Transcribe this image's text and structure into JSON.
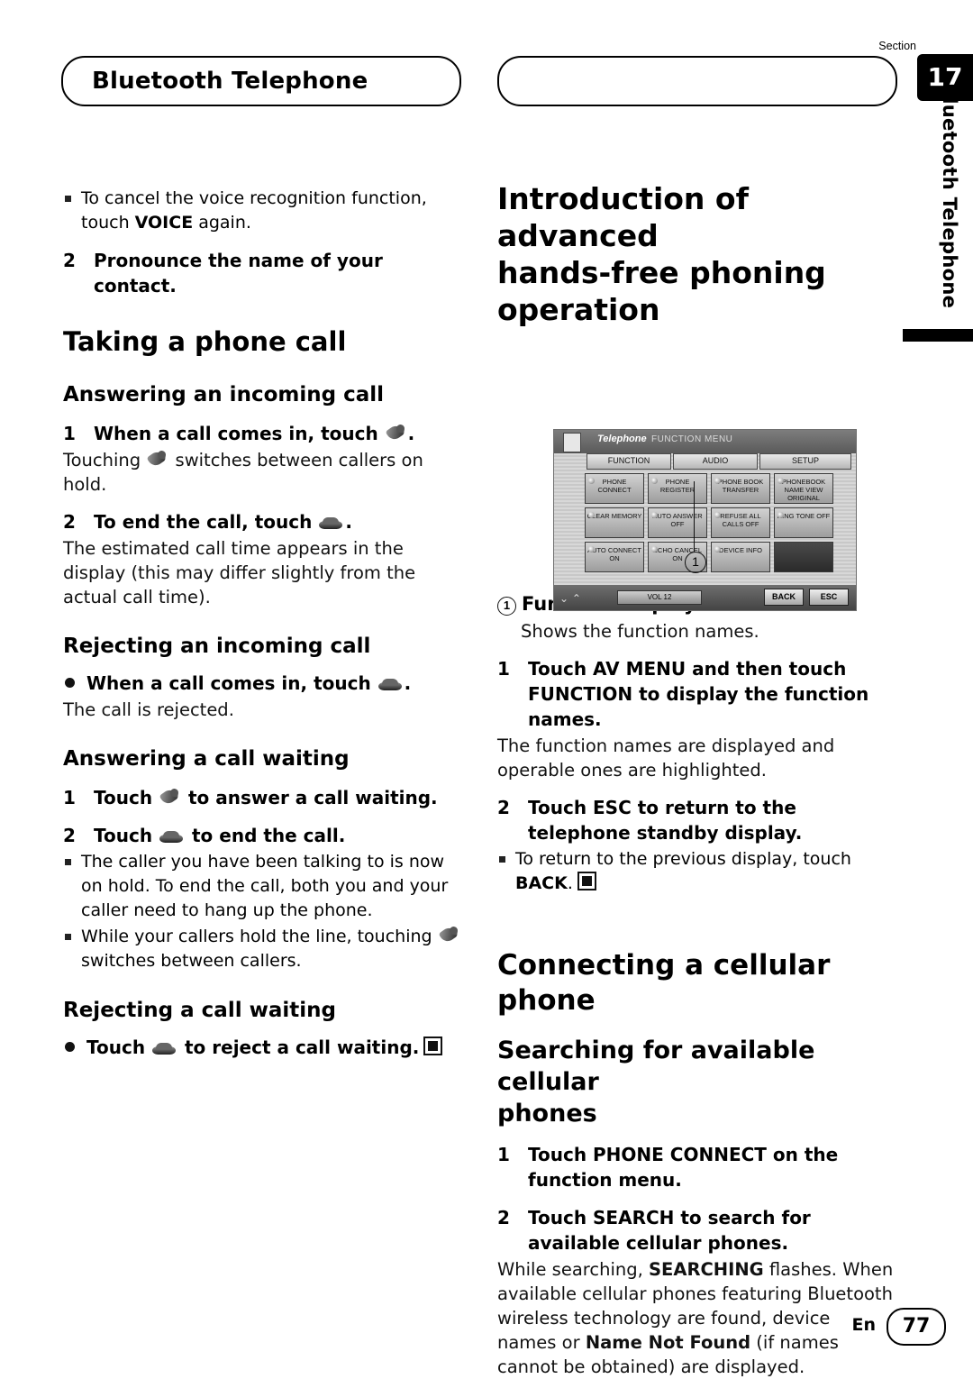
{
  "header": {
    "title": "Bluetooth Telephone",
    "section_word": "Section",
    "section_number": "17",
    "side_tab": "Bluetooth Telephone"
  },
  "left_column": {
    "note_voice": "To cancel the voice recognition function, touch VOICE again.",
    "note_voice_plain_1": "To cancel the voice recognition function, touch ",
    "note_voice_bold": "VOICE",
    "note_voice_plain_2": " again.",
    "step2_pronounce_num": "2",
    "step2_pronounce": "Pronounce the name of your contact.",
    "h_taking": "Taking a phone call",
    "h_answering_incoming": "Answering an incoming call",
    "s1_num": "1",
    "s1_text_a": "When a call comes in, touch",
    "s1_text_b": ".",
    "p_touching_a": "Touching",
    "p_touching_b": "switches between callers on hold.",
    "s2_num": "2",
    "s2_text_a": "To end the call, touch",
    "s2_text_b": ".",
    "p_estimated": "The estimated call time appears in the display (this may differ slightly from the actual call time).",
    "h_rejecting_incoming": "Rejecting an incoming call",
    "b_when_call_comes": "When a call comes in, touch",
    "b_when_call_comes_end": ".",
    "p_call_rejected": "The call is rejected.",
    "h_answering_waiting": "Answering a call waiting",
    "w1_num": "1",
    "w1_a": "Touch",
    "w1_b": "to answer a call waiting.",
    "w2_num": "2",
    "w2_a": "Touch",
    "w2_b": "to end the call.",
    "note_caller_hold": "The caller you have been talking to is now on hold. To end the call, both you and your caller need to hang up the phone.",
    "note_while_hold_a": "While your callers hold the line, touching",
    "note_while_hold_b": "switches between callers.",
    "h_rejecting_waiting": "Rejecting a call waiting",
    "b_reject_a": "Touch",
    "b_reject_b": "to reject a call waiting."
  },
  "right_column": {
    "h_intro_line1": "Introduction of advanced",
    "h_intro_line2": "hands-free phoning operation",
    "callout_1": "1",
    "callout_label_num": "1",
    "callout_label": "Function display",
    "callout_desc": "Shows the function names.",
    "r1_num": "1",
    "r1_text": "Touch AV MENU and then touch FUNCTION to display the function names.",
    "r1_body": "The function names are displayed and operable ones are highlighted.",
    "r2_num": "2",
    "r2_text": "Touch ESC to return to the telephone standby display.",
    "r2_note_a": "To return to the previous display, touch",
    "r2_note_bold": "BACK",
    "r2_note_b": ".",
    "h_connecting": "Connecting a cellular phone",
    "h_searching_l1": "Searching for available cellular",
    "h_searching_l2": "phones",
    "c1_num": "1",
    "c1_text": "Touch PHONE CONNECT on the function menu.",
    "c2_num": "2",
    "c2_text": "Touch SEARCH to search for available cellular phones.",
    "c2_body_1": "While searching, ",
    "c2_body_bold1": "SEARCHING",
    "c2_body_2": " flashes. When available cellular phones featuring Bluetooth wireless technology are found, device names or ",
    "c2_body_bold2": "Name Not Found",
    "c2_body_3": " (if names cannot be obtained) are displayed."
  },
  "device_screenshot": {
    "title_italic": "Telephone",
    "title_menu": "FUNCTION MENU",
    "tabs": [
      "FUNCTION",
      "AUDIO",
      "SETUP"
    ],
    "cells": [
      "PHONE CONNECT",
      "PHONE REGISTER",
      "PHONE BOOK TRANSFER",
      "PHONEBOOK NAME VIEW ORIGINAL",
      "CLEAR MEMORY",
      "AUTO ANSWER OFF",
      "REFUSE ALL CALLS OFF",
      "RING TONE OFF",
      "AUTO CONNECT ON",
      "ECHO CANCEL ON",
      "DEVICE INFO",
      ""
    ],
    "vol_label": "VOL 12",
    "back_label": "BACK",
    "esc_label": "ESC"
  },
  "footer": {
    "lang": "En",
    "page": "77"
  }
}
